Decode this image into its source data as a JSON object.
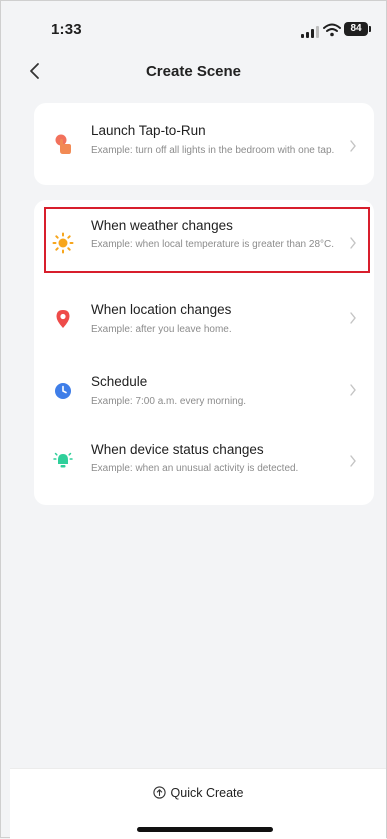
{
  "status_bar": {
    "time": "1:33",
    "battery": "84",
    "signal_icon": "cellular-signal-icon",
    "wifi_icon": "wifi-icon"
  },
  "nav": {
    "title": "Create Scene",
    "back_icon": "chevron-left-icon"
  },
  "launch_card": {
    "title": "Launch Tap-to-Run",
    "description": "Example: turn off all lights in the bedroom with one tap.",
    "icon": "tap-hand-icon",
    "icon_color": "#f0583f"
  },
  "conditions": [
    {
      "title": "When weather changes",
      "description": "Example: when local temperature is greater than 28°C.",
      "icon": "sun-icon",
      "icon_color": "#f7a51b",
      "highlighted": true
    },
    {
      "title": "When location changes",
      "description": "Example: after you leave home.",
      "icon": "location-pin-icon",
      "icon_color": "#ee4b49"
    },
    {
      "title": "Schedule",
      "description": "Example: 7:00 a.m. every morning.",
      "icon": "clock-icon",
      "icon_color": "#3f7ee8"
    },
    {
      "title": "When device status changes",
      "description": "Example: when an unusual activity is detected.",
      "icon": "device-icon",
      "icon_color": "#2fcf9a"
    }
  ],
  "bottom": {
    "quick_create_label": "Quick Create",
    "quick_create_icon": "arrow-up-circle-icon"
  },
  "colors": {
    "background": "#f3f4f6",
    "card": "#ffffff",
    "highlight": "#d81e2c"
  }
}
